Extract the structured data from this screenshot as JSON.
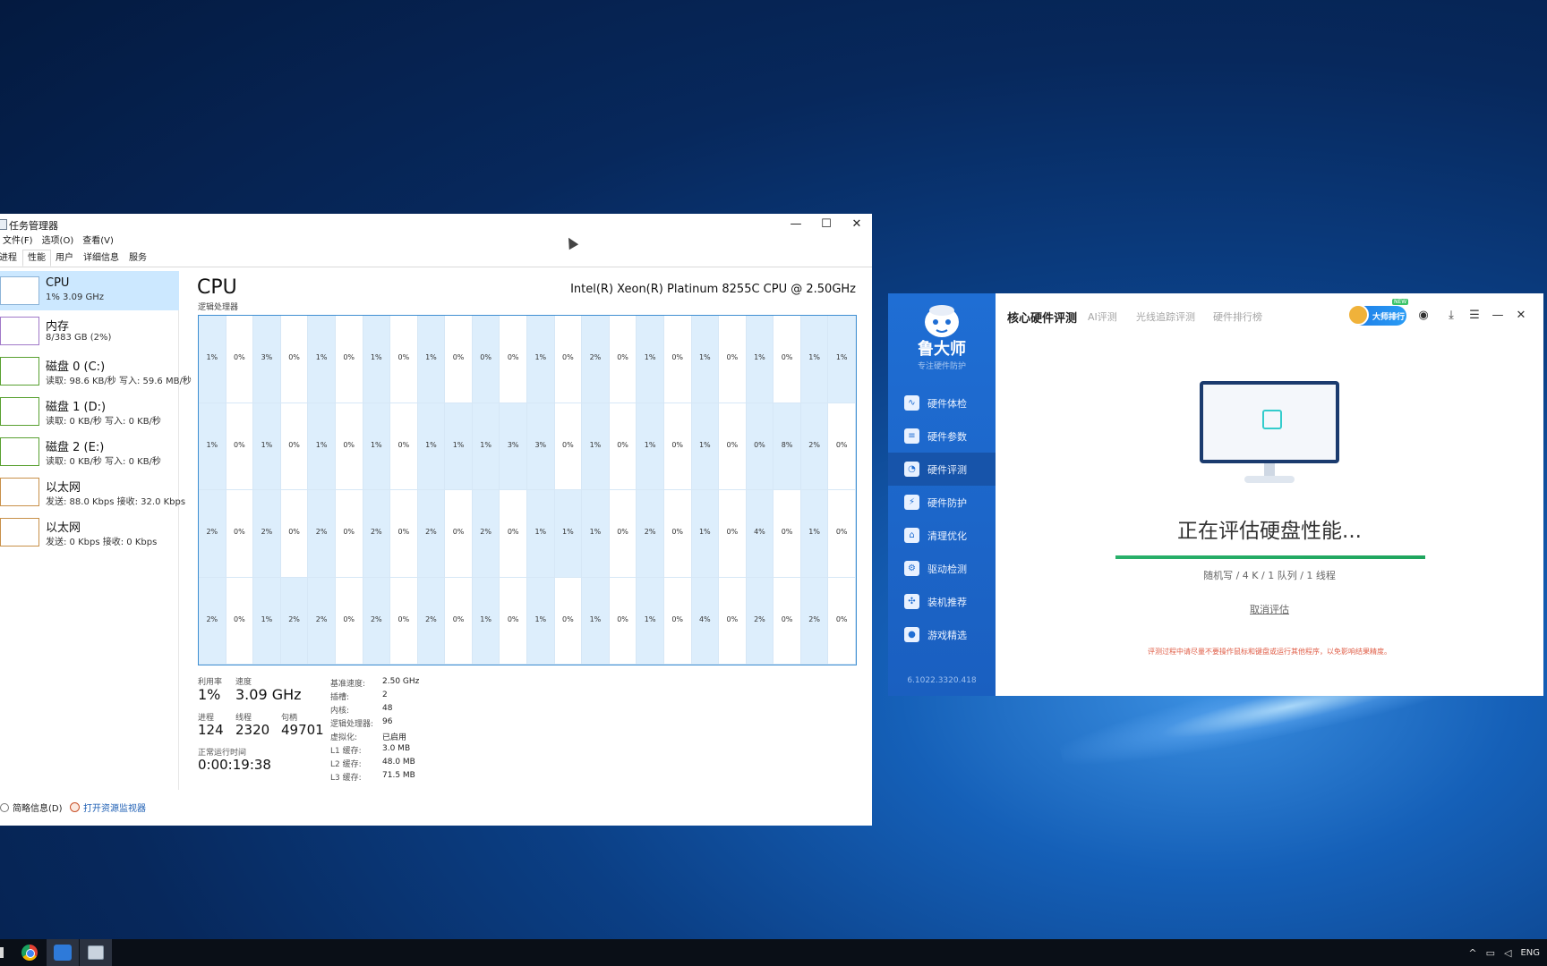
{
  "task_manager": {
    "title": "任务管理器",
    "menu": [
      "文件(F)",
      "选项(O)",
      "查看(V)"
    ],
    "tabs": [
      "进程",
      "性能",
      "用户",
      "详细信息",
      "服务"
    ],
    "active_tab": "性能",
    "sidebar": [
      {
        "name": "CPU",
        "sub": "1% 3.09 GHz"
      },
      {
        "name": "内存",
        "sub": "8/383 GB (2%)"
      },
      {
        "name": "磁盘 0 (C:)",
        "sub": "读取: 98.6 KB/秒 写入: 59.6 MB/秒"
      },
      {
        "name": "磁盘 1 (D:)",
        "sub": "读取: 0 KB/秒 写入: 0 KB/秒"
      },
      {
        "name": "磁盘 2 (E:)",
        "sub": "读取: 0 KB/秒 写入: 0 KB/秒"
      },
      {
        "name": "以太网",
        "sub": "发送: 88.0 Kbps 接收: 32.0 Kbps"
      },
      {
        "name": "以太网",
        "sub": "发送: 0 Kbps 接收: 0 Kbps"
      }
    ],
    "cpu": {
      "heading": "CPU",
      "model": "Intel(R) Xeon(R) Platinum 8255C CPU @ 2.50GHz",
      "grid_label": "逻辑处理器",
      "cores": [
        [
          "1%",
          "0%",
          "3%",
          "0%",
          "1%",
          "0%",
          "1%",
          "0%",
          "1%",
          "0%",
          "0%",
          "0%",
          "1%",
          "0%",
          "2%",
          "0%",
          "1%",
          "0%",
          "1%",
          "0%",
          "1%",
          "0%",
          "1%",
          "1%"
        ],
        [
          "1%",
          "0%",
          "1%",
          "0%",
          "1%",
          "0%",
          "1%",
          "0%",
          "1%",
          "1%",
          "1%",
          "3%",
          "3%",
          "0%",
          "1%",
          "0%",
          "1%",
          "0%",
          "1%",
          "0%",
          "0%",
          "8%",
          "2%",
          "0%"
        ],
        [
          "2%",
          "0%",
          "2%",
          "0%",
          "2%",
          "0%",
          "2%",
          "0%",
          "2%",
          "0%",
          "2%",
          "0%",
          "1%",
          "1%",
          "1%",
          "0%",
          "2%",
          "0%",
          "1%",
          "0%",
          "4%",
          "0%",
          "1%",
          "0%"
        ],
        [
          "2%",
          "0%",
          "1%",
          "2%",
          "2%",
          "0%",
          "2%",
          "0%",
          "2%",
          "0%",
          "1%",
          "0%",
          "1%",
          "0%",
          "1%",
          "0%",
          "1%",
          "0%",
          "4%",
          "0%",
          "2%",
          "0%",
          "2%",
          "0%"
        ]
      ],
      "stats": {
        "util_label": "利用率",
        "util": "1%",
        "speed_label": "速度",
        "speed": "3.09 GHz",
        "proc_label": "进程",
        "proc": "124",
        "threads_label": "线程",
        "threads": "2320",
        "handles_label": "句柄",
        "handles": "49701",
        "uptime_label": "正常运行时间",
        "uptime": "0:00:19:38"
      },
      "specs": [
        {
          "k": "基准速度:",
          "v": "2.50 GHz"
        },
        {
          "k": "插槽:",
          "v": "2"
        },
        {
          "k": "内核:",
          "v": "48"
        },
        {
          "k": "逻辑处理器:",
          "v": "96"
        },
        {
          "k": "虚拟化:",
          "v": "已启用"
        },
        {
          "k": "L1 缓存:",
          "v": "3.0 MB"
        },
        {
          "k": "L2 缓存:",
          "v": "48.0 MB"
        },
        {
          "k": "L3 缓存:",
          "v": "71.5 MB"
        }
      ]
    },
    "footer": {
      "fewer": "简略信息(D)",
      "resmon": "打开资源监视器"
    }
  },
  "ludashi": {
    "brand": "鲁大师",
    "slogan": "专注硬件防护",
    "nav": [
      "硬件体检",
      "硬件参数",
      "硬件评测",
      "硬件防护",
      "清理优化",
      "驱动检测",
      "装机推荐",
      "游戏精选"
    ],
    "active_nav": "硬件评测",
    "version": "6.1022.3320.418",
    "tabs": [
      "核心硬件评测",
      "AI评测",
      "光线追踪评测",
      "硬件排行榜"
    ],
    "badge": "大师排行",
    "badge_new": "NEW",
    "eval_title": "正在评估硬盘性能...",
    "progress": 1.0,
    "eval_sub": "随机写 / 4 K / 1 队列 / 1 线程",
    "cancel": "取消评估",
    "warning": "评测过程中请尽量不要操作鼠标和键盘或运行其他程序，以免影响结果精度。"
  },
  "taskbar": {
    "tray_lang": "ENG"
  },
  "colors": {
    "tm_grid_border": "#3f8fd2",
    "tm_cell_shade": "#ddeefc",
    "lds_blue": "#1f6ed4",
    "progress_green": "#22a862"
  }
}
